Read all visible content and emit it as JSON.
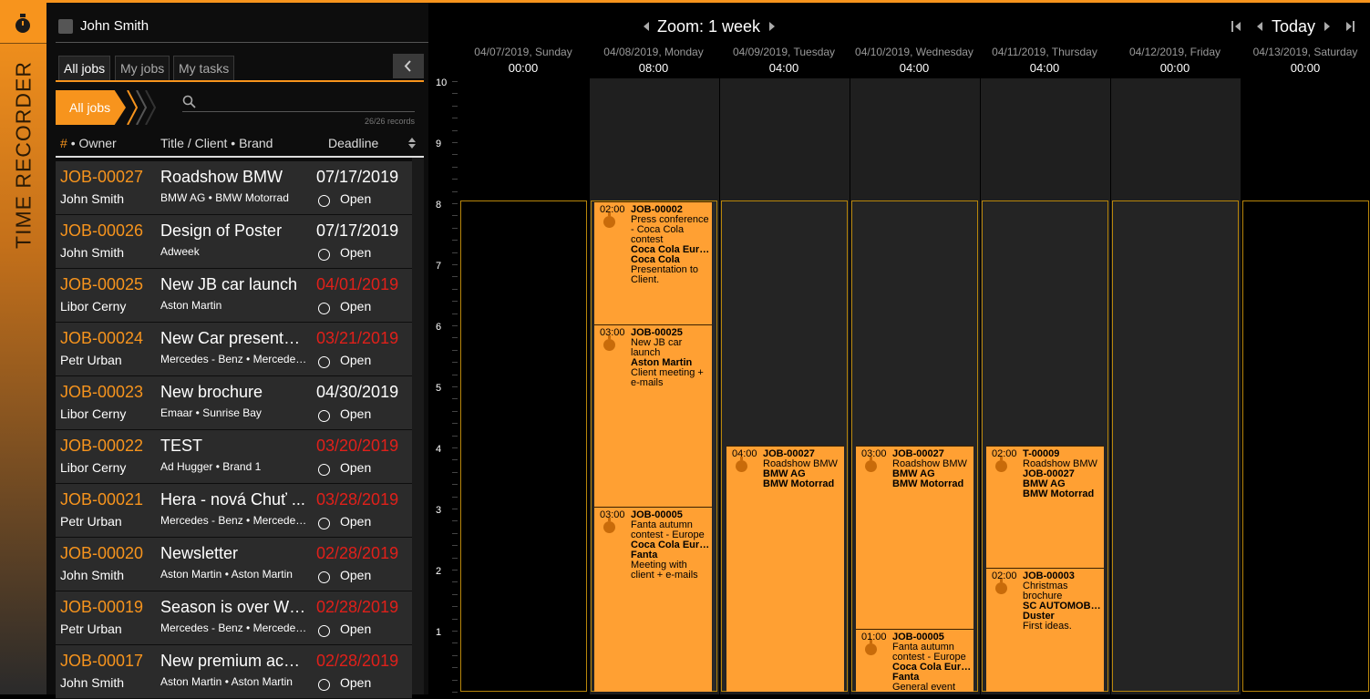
{
  "app": {
    "title": "TIME RECORDER"
  },
  "user": {
    "name": "John Smith"
  },
  "tabs": [
    {
      "label": "All jobs"
    },
    {
      "label": "My jobs"
    },
    {
      "label": "My tasks"
    }
  ],
  "filter": {
    "breadcrumb": "All jobs",
    "search_placeholder": "",
    "records": "26/26 records"
  },
  "table": {
    "headers": {
      "hash": "#",
      "owner": "• Owner",
      "title": "Title / Client • Brand",
      "deadline": "Deadline"
    },
    "rows": [
      {
        "id": "JOB-00027",
        "owner": "John Smith",
        "title": "Roadshow BMW",
        "client": "BMW AG • BMW Motorrad",
        "deadline": "07/17/2019",
        "overdue": false,
        "status": "Open"
      },
      {
        "id": "JOB-00026",
        "owner": "John Smith",
        "title": "Design of Poster",
        "client": "Adweek",
        "deadline": "07/17/2019",
        "overdue": false,
        "status": "Open"
      },
      {
        "id": "JOB-00025",
        "owner": "Libor Cerny",
        "title": "New JB car launch",
        "client": "Aston Martin",
        "deadline": "04/01/2019",
        "overdue": true,
        "status": "Open"
      },
      {
        "id": "JOB-00024",
        "owner": "Petr Urban",
        "title": "New Car presentation",
        "client": "Mercedes - Benz • Mercedes - Benz",
        "deadline": "03/21/2019",
        "overdue": true,
        "status": "Open"
      },
      {
        "id": "JOB-00023",
        "owner": "Libor Cerny",
        "title": "New brochure",
        "client": "Emaar • Sunrise Bay",
        "deadline": "04/30/2019",
        "overdue": false,
        "status": "Open"
      },
      {
        "id": "JOB-00022",
        "owner": "Libor Cerny",
        "title": "TEST",
        "client": "Ad Hugger • Brand 1",
        "deadline": "03/20/2019",
        "overdue": true,
        "status": "Open"
      },
      {
        "id": "JOB-00021",
        "owner": "Petr Urban",
        "title": "Hera - nová Chuť ...",
        "client": "Mercedes - Benz • Mercedes - Benz",
        "deadline": "03/28/2019",
        "overdue": true,
        "status": "Open"
      },
      {
        "id": "JOB-00020",
        "owner": "John Smith",
        "title": "Newsletter",
        "client": "Aston Martin • Aston Martin",
        "deadline": "02/28/2019",
        "overdue": true,
        "status": "Open"
      },
      {
        "id": "JOB-00019",
        "owner": "Petr Urban",
        "title": "Season is over WI...",
        "client": "Mercedes - Benz • Mercedes - Benz",
        "deadline": "02/28/2019",
        "overdue": true,
        "status": "Open"
      },
      {
        "id": "JOB-00017",
        "owner": "John Smith",
        "title": "New premium accessories",
        "client": "Aston Martin • Aston Martin",
        "deadline": "02/28/2019",
        "overdue": true,
        "status": "Open"
      }
    ]
  },
  "calendar": {
    "zoom": "Zoom: 1 week",
    "today": "Today",
    "days": [
      {
        "name": "04/07/2019, Sunday",
        "time": "00:00"
      },
      {
        "name": "04/08/2019, Monday",
        "time": "08:00"
      },
      {
        "name": "04/09/2019, Tuesday",
        "time": "04:00"
      },
      {
        "name": "04/10/2019, Wednesday",
        "time": "04:00"
      },
      {
        "name": "04/11/2019, Thursday",
        "time": "04:00"
      },
      {
        "name": "04/12/2019, Friday",
        "time": "00:00"
      },
      {
        "name": "04/13/2019, Saturday",
        "time": "00:00"
      }
    ],
    "hours": [
      "10",
      "9",
      "8",
      "7",
      "6",
      "5",
      "4",
      "3",
      "2",
      "1"
    ],
    "events": [
      {
        "time": "02:00",
        "job": "JOB-00002",
        "desc": "Press conference - Coca Cola contest",
        "client": "Coca Cola Europe",
        "brand": "Coca Cola",
        "note": "Presentation to Client."
      },
      {
        "time": "03:00",
        "job": "JOB-00025",
        "desc": "New JB car launch",
        "client": "Aston Martin",
        "brand": "",
        "note": "Client meeting + e-mails"
      },
      {
        "time": "03:00",
        "job": "JOB-00005",
        "desc": "Fanta autumn contest - Europe",
        "client": "Coca Cola Europe",
        "brand": "Fanta",
        "note": "Meeting with client + e-mails"
      },
      {
        "time": "04:00",
        "job": "JOB-00027",
        "desc": "Roadshow BMW",
        "client": "BMW AG",
        "brand": "BMW Motorrad",
        "note": ""
      },
      {
        "time": "03:00",
        "job": "JOB-00027",
        "desc": "Roadshow BMW",
        "client": "BMW AG",
        "brand": "BMW Motorrad",
        "note": ""
      },
      {
        "time": "01:00",
        "job": "JOB-00005",
        "desc": "Fanta autumn contest - Europe",
        "client": "Coca Cola Europe",
        "brand": "Fanta",
        "note": "General event"
      },
      {
        "time": "02:00",
        "job": "T-00009",
        "desc": "Roadshow BMW",
        "job2": "JOB-00027",
        "client": "BMW AG",
        "brand": "BMW Motorrad",
        "note": ""
      },
      {
        "time": "02:00",
        "job": "JOB-00003",
        "desc": "Christmas brochure",
        "client": "SC AUTOMOBILE",
        "brand": "Duster",
        "note": "First ideas."
      }
    ]
  },
  "colors": {
    "accent": "#f7941d",
    "overdue": "#e0201a",
    "event": "#ffa033"
  }
}
